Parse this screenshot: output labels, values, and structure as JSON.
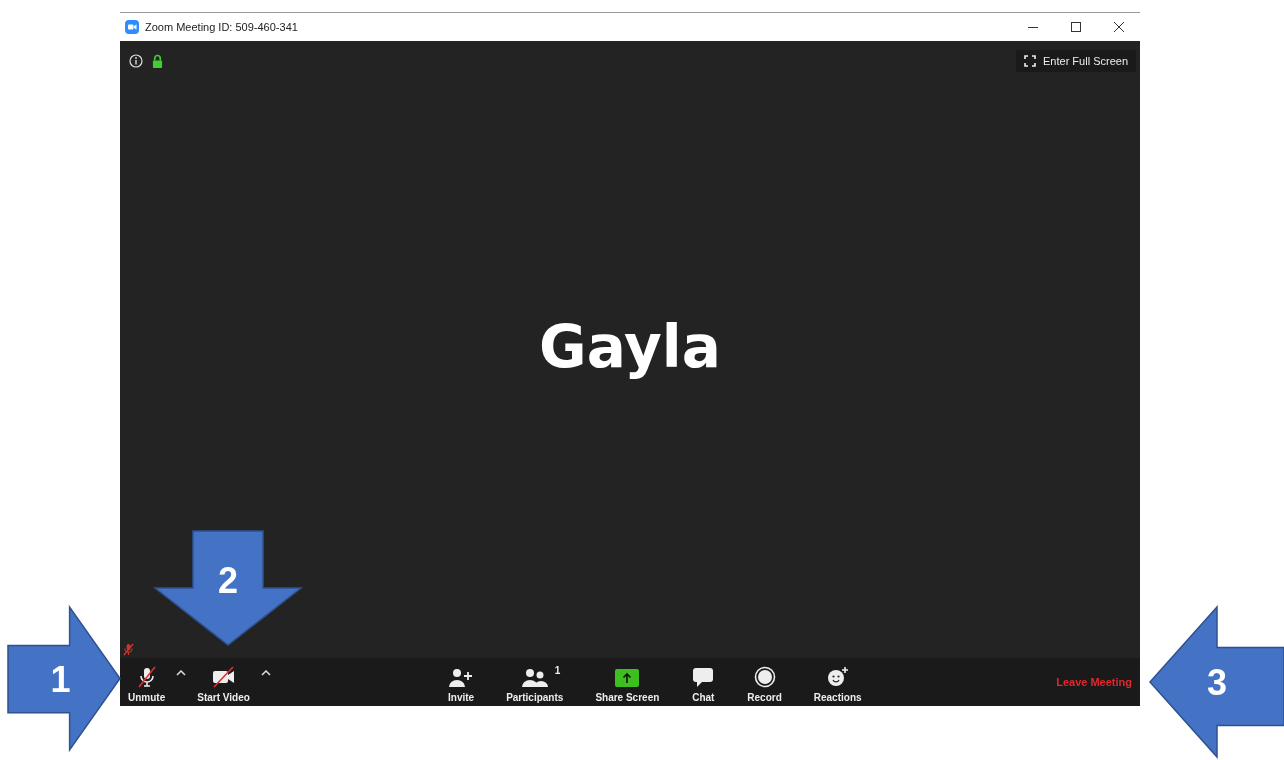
{
  "window": {
    "title": "Zoom Meeting ID: 509-460-341",
    "controls": [
      {
        "kind": "minimize"
      },
      {
        "kind": "maximize"
      },
      {
        "kind": "close"
      }
    ]
  },
  "video": {
    "secure": true,
    "fullscreen_label": "Enter Full Screen",
    "participant_name": "Gayla",
    "muted": true
  },
  "toolbar": {
    "left": [
      {
        "kind": "mic",
        "label": "Unmute",
        "muted": true
      },
      {
        "kind": "video",
        "label": "Start Video",
        "muted": true
      }
    ],
    "center": [
      {
        "kind": "invite",
        "label": "Invite"
      },
      {
        "kind": "participants",
        "label": "Participants",
        "count": "1"
      },
      {
        "kind": "share",
        "label": "Share Screen"
      },
      {
        "kind": "chat",
        "label": "Chat"
      },
      {
        "kind": "record",
        "label": "Record"
      },
      {
        "kind": "reactions",
        "label": "Reactions"
      }
    ],
    "leave_label": "Leave Meeting"
  },
  "callouts": [
    {
      "label": "1",
      "kind": "right"
    },
    {
      "label": "2",
      "kind": "down"
    },
    {
      "label": "3",
      "kind": "left"
    }
  ]
}
